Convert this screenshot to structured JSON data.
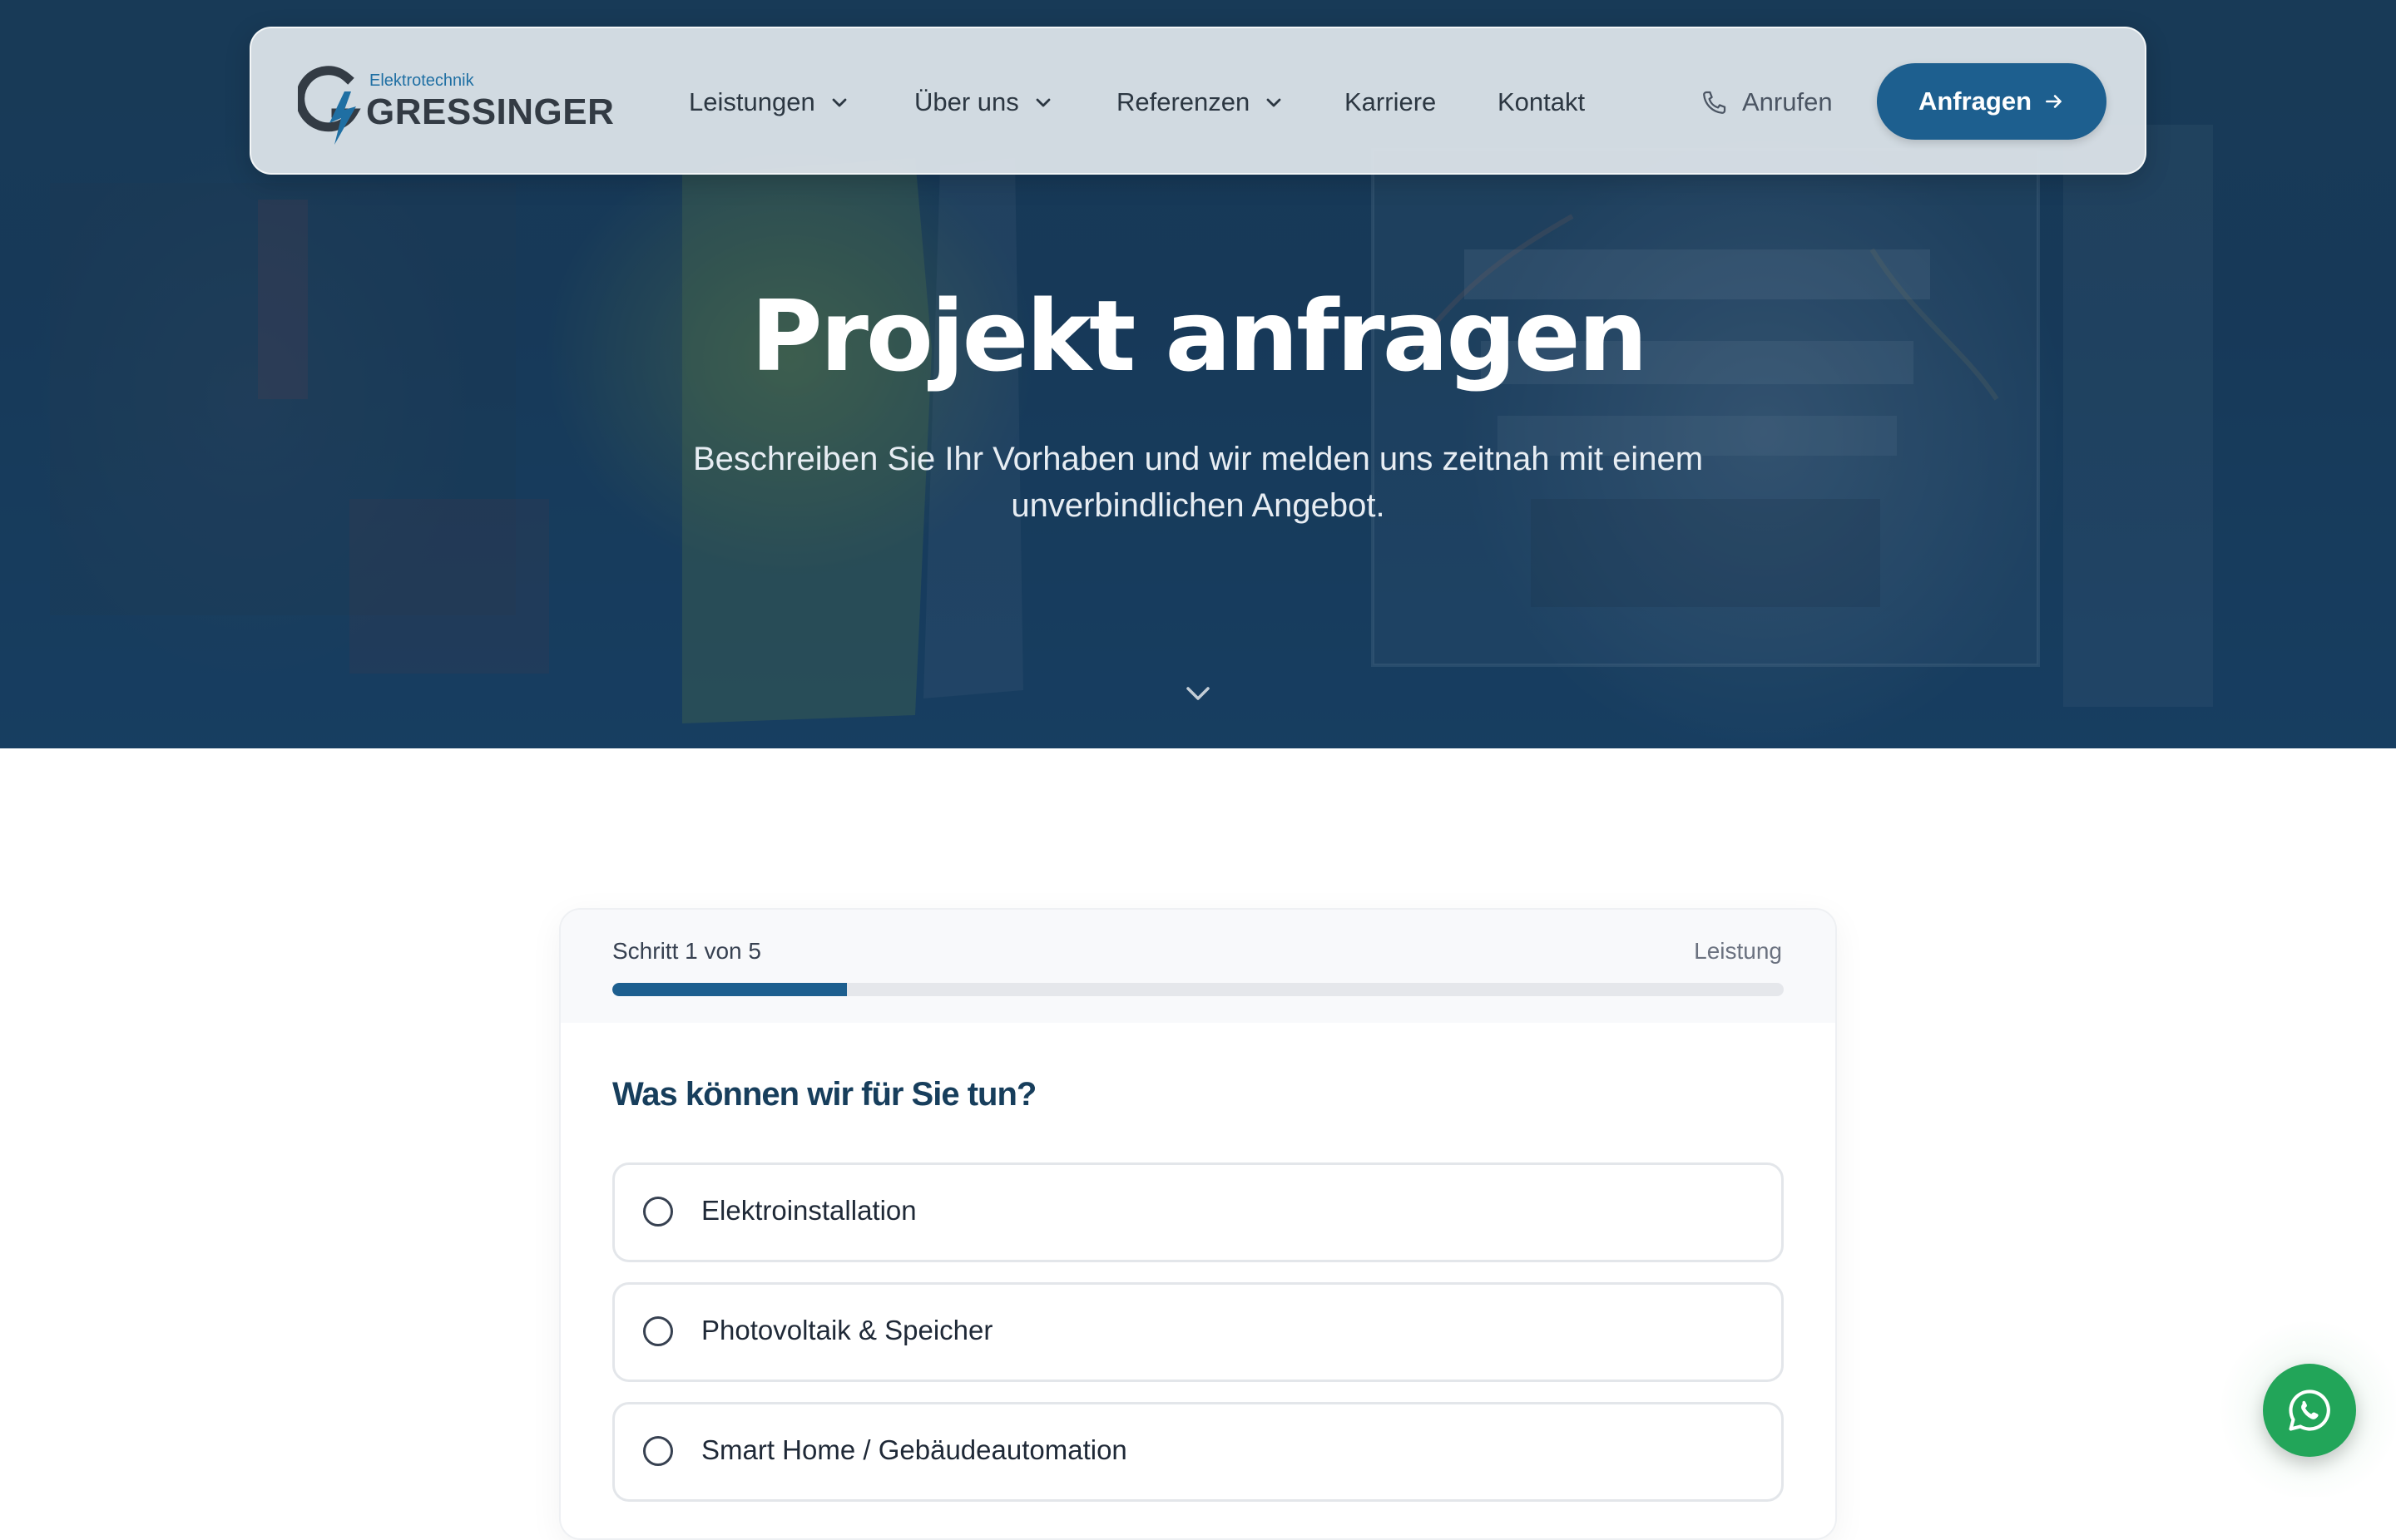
{
  "brand": {
    "sub": "Elektrotechnik",
    "name": "GRESSINGER",
    "color_primary": "#1d5f8f",
    "color_heading": "#173e5c"
  },
  "nav": {
    "items": [
      {
        "label": "Leistungen",
        "has_dropdown": true
      },
      {
        "label": "Über uns",
        "has_dropdown": true
      },
      {
        "label": "Referenzen",
        "has_dropdown": true
      },
      {
        "label": "Karriere",
        "has_dropdown": false
      },
      {
        "label": "Kontakt",
        "has_dropdown": false
      }
    ],
    "call_label": "Anrufen",
    "call_icon": "phone-icon",
    "cta_label": "Anfragen",
    "cta_icon": "arrow-right-icon"
  },
  "hero": {
    "title": "Projekt anfragen",
    "subtitle": "Beschreiben Sie Ihr Vorhaben und wir melden uns zeitnah mit einem unverbindlichen Angebot.",
    "scroll_icon": "chevron-down-icon"
  },
  "form": {
    "step_text": "Schritt 1 von 5",
    "step_name": "Leistung",
    "progress": 0.2,
    "question": "Was können wir für Sie tun?",
    "options": [
      {
        "label": "Elektroinstallation",
        "selected": false
      },
      {
        "label": "Photovoltaik & Speicher",
        "selected": false
      },
      {
        "label": "Smart Home / Gebäudeautomation",
        "selected": false
      }
    ]
  },
  "whatsapp": {
    "icon": "whatsapp-icon",
    "color": "#22a559"
  }
}
